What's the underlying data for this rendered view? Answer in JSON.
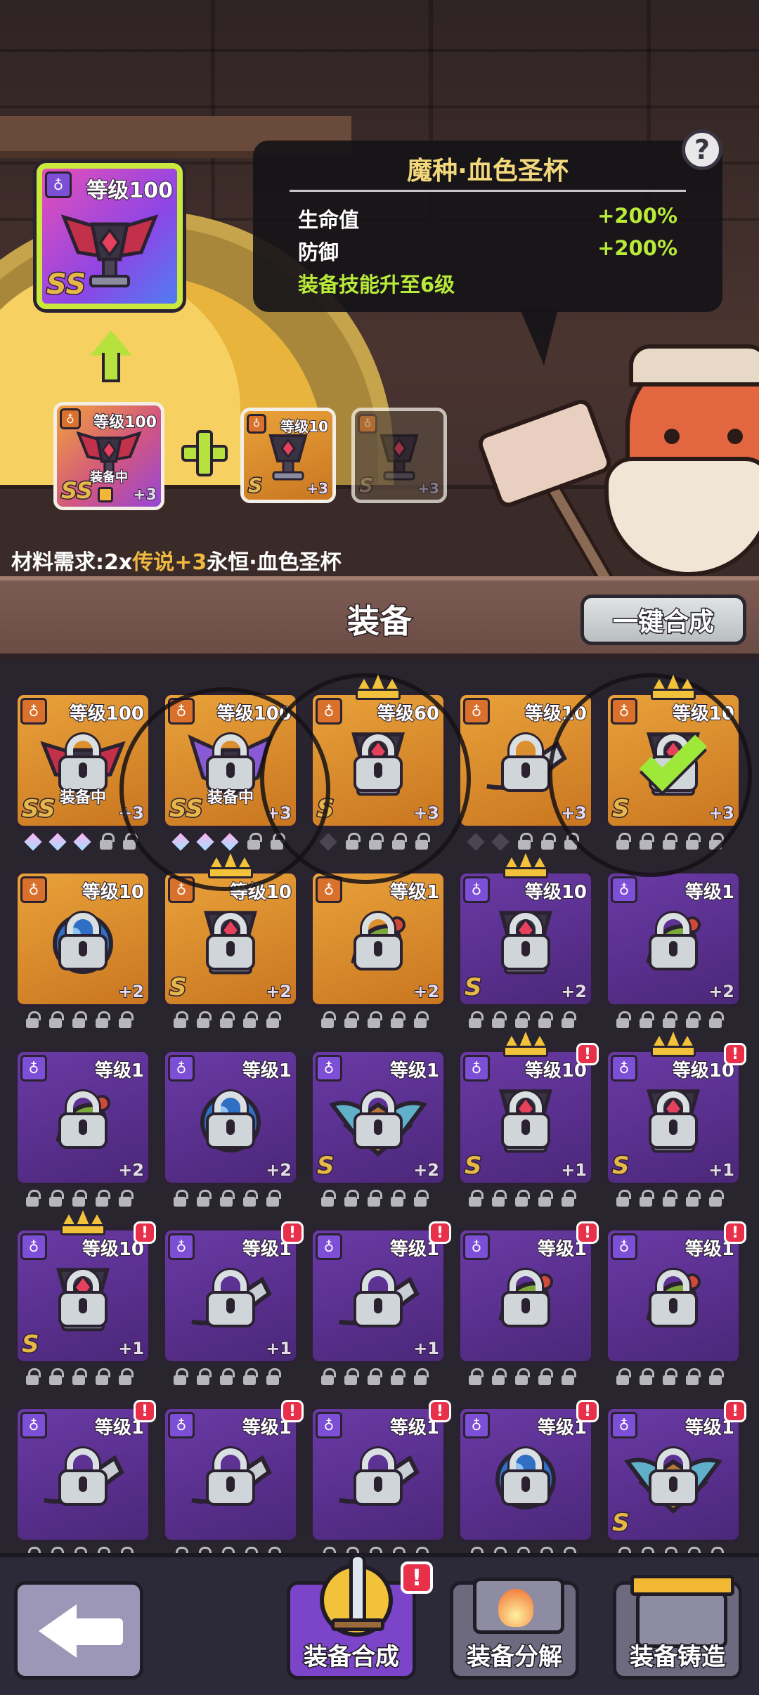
{
  "result": {
    "level": "等级100",
    "grade": "SS"
  },
  "info": {
    "title": "魔种·血色圣杯",
    "stats": [
      {
        "label": "生命值",
        "value": "+200%"
      },
      {
        "label": "防御",
        "value": "+200%"
      }
    ],
    "skill": "装备技能升至6级",
    "help": "?"
  },
  "materials": [
    {
      "level": "等级100",
      "grade": "SS",
      "plus": "+3",
      "status": "装备中"
    },
    {
      "level": "等级10",
      "grade": "S",
      "plus": "+3"
    },
    {
      "level": "",
      "grade": "S",
      "plus": "+3"
    }
  ],
  "requirement": {
    "prefix": "材料需求:2x",
    "tier": "传说",
    "plus": "+3",
    "name": "永恒·血色圣杯"
  },
  "section": {
    "title": "装备",
    "oneclick_label": "一键合成"
  },
  "grid": [
    {
      "level": "等级100",
      "grade": "SS",
      "plus": "+3",
      "status": "装备中",
      "bg": "gold",
      "item": "chalice-wings",
      "gems": "ddd11"
    },
    {
      "level": "等级100",
      "grade": "SS",
      "plus": "+3",
      "status": "装备中",
      "bg": "gold",
      "item": "purple-wings",
      "gems": "ddd11"
    },
    {
      "level": "等级60",
      "grade": "S",
      "plus": "+3",
      "status": "",
      "bg": "gold",
      "item": "chalice",
      "gems": "x1111",
      "crown": true
    },
    {
      "level": "等级10",
      "grade": "",
      "plus": "+3",
      "status": "",
      "bg": "gold",
      "item": "horn",
      "gems": "xx111"
    },
    {
      "level": "等级10",
      "grade": "S",
      "plus": "+3",
      "status": "",
      "bg": "gold",
      "item": "chalice",
      "gems": "11111",
      "crown": true,
      "check": true
    },
    {
      "level": "等级10",
      "grade": "",
      "plus": "+2",
      "status": "",
      "bg": "gold",
      "item": "orb",
      "gems": "11111"
    },
    {
      "level": "等级10",
      "grade": "S",
      "plus": "+2",
      "status": "",
      "bg": "gold",
      "item": "chalice",
      "gems": "11111",
      "crown": true
    },
    {
      "level": "等级1",
      "grade": "",
      "plus": "+2",
      "status": "",
      "bg": "gold",
      "item": "amulet",
      "gems": "11111"
    },
    {
      "level": "等级10",
      "grade": "S",
      "plus": "+2",
      "status": "",
      "bg": "purple",
      "item": "chalice",
      "gems": "11111",
      "crown": true
    },
    {
      "level": "等级1",
      "grade": "",
      "plus": "+2",
      "status": "",
      "bg": "purple",
      "item": "amulet",
      "gems": "11111"
    },
    {
      "level": "等级1",
      "grade": "",
      "plus": "+2",
      "status": "",
      "bg": "purple",
      "item": "amulet",
      "gems": "11111"
    },
    {
      "level": "等级1",
      "grade": "",
      "plus": "+2",
      "status": "",
      "bg": "purple",
      "item": "orb",
      "gems": "11111"
    },
    {
      "level": "等级1",
      "grade": "S",
      "plus": "+2",
      "status": "",
      "bg": "purple",
      "item": "wings",
      "gems": "11111"
    },
    {
      "level": "等级10",
      "grade": "S",
      "plus": "+1",
      "status": "",
      "bg": "purple",
      "item": "chalice",
      "gems": "11111",
      "crown": true,
      "alert": true
    },
    {
      "level": "等级10",
      "grade": "S",
      "plus": "+1",
      "status": "",
      "bg": "purple",
      "item": "chalice",
      "gems": "11111",
      "crown": true,
      "alert": true
    },
    {
      "level": "等级10",
      "grade": "S",
      "plus": "+1",
      "status": "",
      "bg": "purple",
      "item": "chalice",
      "gems": "11111",
      "crown": true,
      "alert": true
    },
    {
      "level": "等级1",
      "grade": "",
      "plus": "+1",
      "status": "",
      "bg": "purple",
      "item": "horn",
      "gems": "11111",
      "alert": true
    },
    {
      "level": "等级1",
      "grade": "",
      "plus": "+1",
      "status": "",
      "bg": "purple",
      "item": "horn",
      "gems": "11111",
      "alert": true
    },
    {
      "level": "等级1",
      "grade": "",
      "plus": "",
      "status": "",
      "bg": "purple",
      "item": "amulet",
      "gems": "11111",
      "alert": true
    },
    {
      "level": "等级1",
      "grade": "",
      "plus": "",
      "status": "",
      "bg": "purple",
      "item": "amulet",
      "gems": "11111",
      "alert": true
    },
    {
      "level": "等级1",
      "grade": "",
      "plus": "",
      "status": "",
      "bg": "purple",
      "item": "horn",
      "gems": "11111",
      "alert": true
    },
    {
      "level": "等级1",
      "grade": "",
      "plus": "",
      "status": "",
      "bg": "purple",
      "item": "horn",
      "gems": "11111",
      "alert": true
    },
    {
      "level": "等级1",
      "grade": "",
      "plus": "",
      "status": "",
      "bg": "purple",
      "item": "horn",
      "gems": "11111",
      "alert": true
    },
    {
      "level": "等级1",
      "grade": "",
      "plus": "",
      "status": "",
      "bg": "purple",
      "item": "orb",
      "gems": "11111",
      "alert": true
    },
    {
      "level": "等级1",
      "grade": "S",
      "plus": "",
      "status": "",
      "bg": "purple",
      "item": "wings",
      "gems": "11111",
      "alert": true
    }
  ],
  "alert_mark": "!",
  "bottom": {
    "tabs": [
      {
        "label": "装备合成"
      },
      {
        "label": "装备分解"
      },
      {
        "label": "装备铸造"
      }
    ],
    "alert_mark": "!"
  },
  "colors": {
    "accent_green": "#b8ea3a",
    "title_gold": "#f2d87a",
    "rarity_purple": "#4b2779",
    "rarity_gold": "#d98a28"
  }
}
